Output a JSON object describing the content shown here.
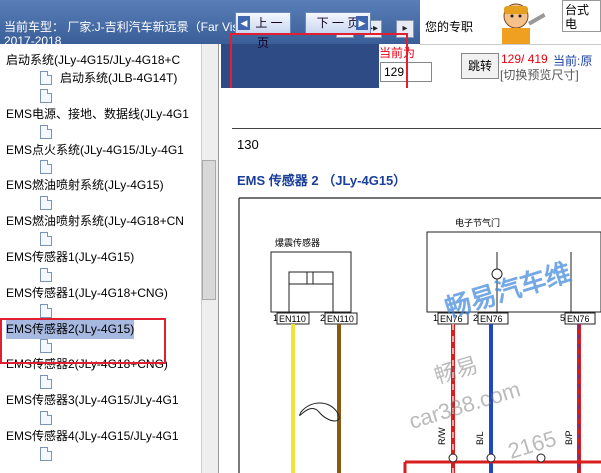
{
  "header": {
    "title": "当前车型：  厂家:J-吉利汽车新远景（Far Vision）",
    "year": "2017-2018",
    "toolbar": [
      "▸",
      "▸▸",
      "▸"
    ],
    "ad_text": "您的专职",
    "ad_box": [
      "台式电"
    ]
  },
  "sidebar": {
    "items": [
      {
        "label": "启动系统(JLy-4G15/JLy-4G18+C",
        "indent": 0,
        "doc": false
      },
      {
        "label": "启动系统(JLB-4G14T)",
        "indent": 1,
        "doc": true
      },
      {
        "label": "",
        "indent": 1,
        "doc": true
      },
      {
        "label": "EMS电源、接地、数据线(JLy-4G1",
        "indent": 0,
        "doc": false
      },
      {
        "label": "",
        "indent": 1,
        "doc": true
      },
      {
        "label": "EMS点火系统(JLy-4G15/JLy-4G1",
        "indent": 0,
        "doc": false
      },
      {
        "label": "",
        "indent": 1,
        "doc": true
      },
      {
        "label": "EMS燃油喷射系统(JLy-4G15)",
        "indent": 0,
        "doc": false
      },
      {
        "label": "",
        "indent": 1,
        "doc": true
      },
      {
        "label": "EMS燃油喷射系统(JLy-4G18+CN",
        "indent": 0,
        "doc": false
      },
      {
        "label": "",
        "indent": 1,
        "doc": true
      },
      {
        "label": "EMS传感器1(JLy-4G15)",
        "indent": 0,
        "doc": false
      },
      {
        "label": "",
        "indent": 1,
        "doc": true
      },
      {
        "label": "EMS传感器1(JLy-4G18+CNG)",
        "indent": 0,
        "doc": false
      },
      {
        "label": "",
        "indent": 1,
        "doc": true
      },
      {
        "label": "EMS传感器2(JLy-4G15)",
        "indent": 0,
        "doc": false,
        "selected": true
      },
      {
        "label": "",
        "indent": 1,
        "doc": true
      },
      {
        "label": "EMS传感器2(JLy-4G18+CNG)",
        "indent": 0,
        "doc": false
      },
      {
        "label": "",
        "indent": 1,
        "doc": true
      },
      {
        "label": "EMS传感器3(JLy-4G15/JLy-4G1",
        "indent": 0,
        "doc": false
      },
      {
        "label": "",
        "indent": 1,
        "doc": true
      },
      {
        "label": "EMS传感器4(JLy-4G15/JLy-4G1",
        "indent": 0,
        "doc": false
      },
      {
        "label": "",
        "indent": 1,
        "doc": true
      }
    ]
  },
  "nav": {
    "prev_label": "上 一 页",
    "next_label": "下 一 页",
    "current_page_label": "当前为",
    "page_value": "129",
    "jump_label": "跳转",
    "page_count": "129/ 419",
    "current_label": "当前:原",
    "switch_label": "[切换预览尺寸]"
  },
  "document": {
    "page_number": "130",
    "title": "EMS 传感器 2 （JLy-4G15）",
    "knock_sensor": "爆震传感器",
    "throttle": "电子节气门",
    "connectors": [
      "EN110",
      "EN110",
      "EN76",
      "EN76",
      "EN76"
    ],
    "pins": [
      "1",
      "2",
      "1",
      "2",
      "5"
    ],
    "wire_labels": [
      "R/W",
      "B/L",
      "B/P"
    ],
    "watermark_text": "畅易汽车维",
    "watermark_small": "畅易",
    "watermark_url": "car388.com",
    "watermark_num": "2165"
  },
  "colors": {
    "header_bg": "#3a5e97",
    "nav_bg": "#2f4b86",
    "highlight_red": "#e02030",
    "title_blue": "#1a3f9a",
    "wire_yellow": "#f2e23a",
    "wire_brown": "#8a5a12",
    "wire_red": "#d81e1e",
    "wire_blue": "#1e48c0"
  }
}
